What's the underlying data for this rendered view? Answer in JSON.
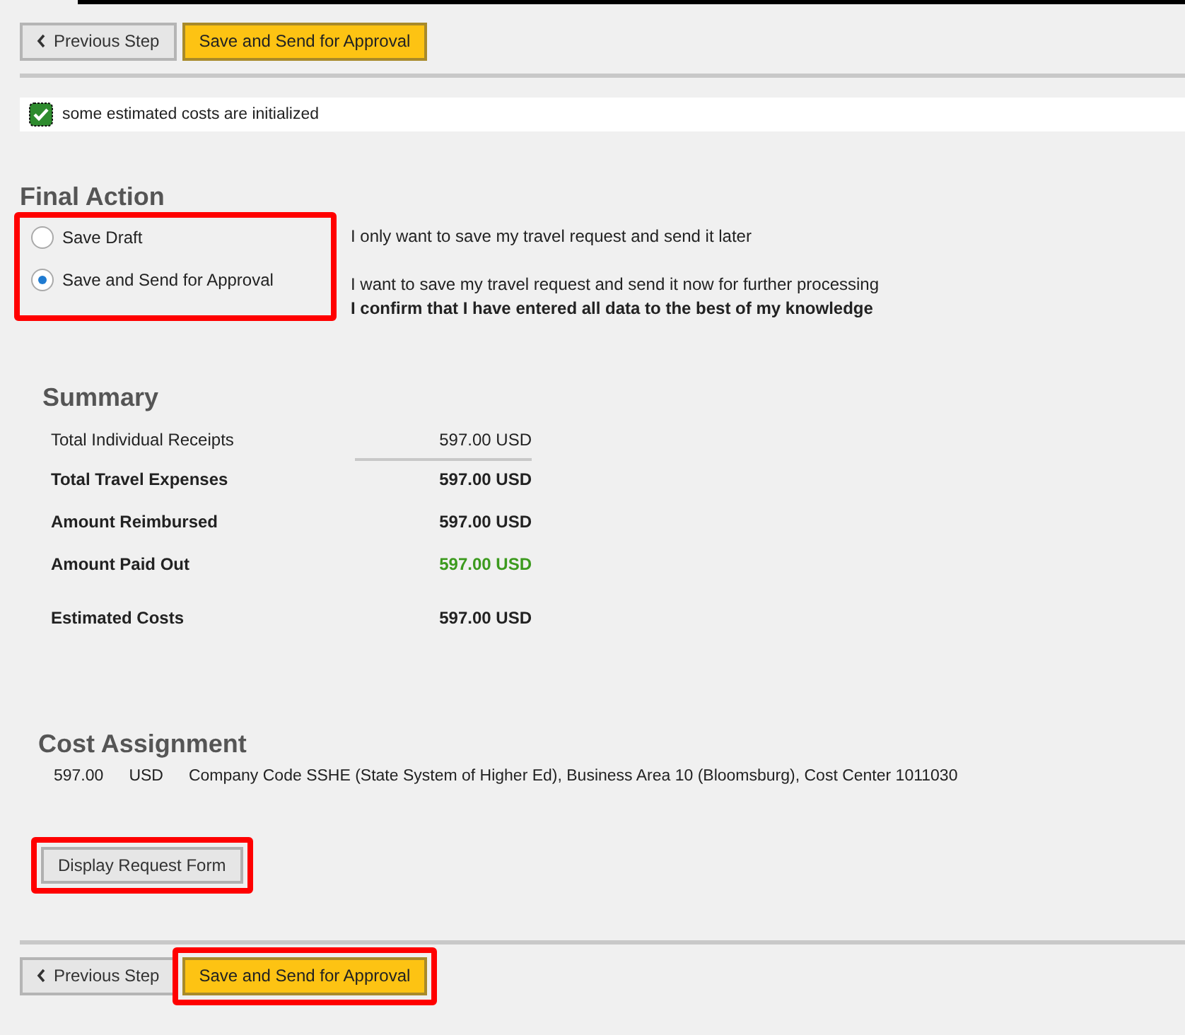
{
  "top_toolbar": {
    "buttons": [
      {
        "label": "Previous Step",
        "kind": "back"
      },
      {
        "label": "Save and Send for Approval",
        "kind": "primary"
      }
    ]
  },
  "message": {
    "text": "some estimated costs are initialized"
  },
  "final_action": {
    "title": "Final Action",
    "highlighted": true,
    "options": [
      {
        "label": "Save Draft",
        "selected": false,
        "description": [
          {
            "text": "I only want to save my travel request and send it later",
            "bold": false
          }
        ]
      },
      {
        "label": "Save and Send for Approval",
        "selected": true,
        "description": [
          {
            "text": "I want to save my travel request and send it now for further processing",
            "bold": false
          },
          {
            "text": "I confirm that I have entered all data to the best of my knowledge",
            "bold": true
          }
        ]
      }
    ]
  },
  "summary": {
    "title": "Summary",
    "rows": [
      {
        "label": "Total Individual Receipts",
        "value": "597.00 USD",
        "bold": false,
        "positive": false,
        "underlined": true
      },
      {
        "label": "Total Travel Expenses",
        "value": "597.00 USD",
        "bold": true,
        "positive": false,
        "underlined": false
      },
      {
        "label": "Amount Reimbursed",
        "value": "597.00 USD",
        "bold": true,
        "positive": false,
        "underlined": false
      },
      {
        "label": "Amount Paid Out",
        "value": "597.00 USD",
        "bold": true,
        "positive": true,
        "underlined": false
      },
      {
        "label": "Estimated Costs",
        "value": "597.00 USD",
        "bold": true,
        "positive": false,
        "underlined": false
      }
    ]
  },
  "cost_assignment": {
    "title": "Cost Assignment",
    "rows": [
      {
        "amount": "597.00",
        "currency": "USD",
        "description": "Company Code SSHE (State System of Higher Ed), Business Area 10 (Bloomsburg), Cost Center 1011030"
      }
    ]
  },
  "display_button": {
    "label": "Display Request Form",
    "highlighted": true
  },
  "bottom_toolbar": {
    "highlighted": true,
    "buttons": [
      {
        "label": "Previous Step",
        "kind": "back"
      },
      {
        "label": "Save and Send for Approval",
        "kind": "primary"
      }
    ]
  }
}
